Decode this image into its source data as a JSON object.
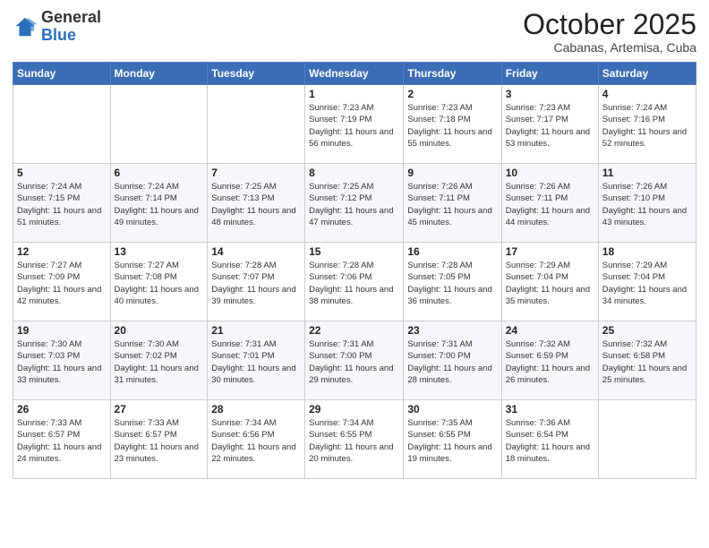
{
  "header": {
    "logo_general": "General",
    "logo_blue": "Blue",
    "month_title": "October 2025",
    "subtitle": "Cabanas, Artemisa, Cuba"
  },
  "weekdays": [
    "Sunday",
    "Monday",
    "Tuesday",
    "Wednesday",
    "Thursday",
    "Friday",
    "Saturday"
  ],
  "weeks": [
    [
      {
        "day": "",
        "info": ""
      },
      {
        "day": "",
        "info": ""
      },
      {
        "day": "",
        "info": ""
      },
      {
        "day": "1",
        "info": "Sunrise: 7:23 AM\nSunset: 7:19 PM\nDaylight: 11 hours and 56 minutes."
      },
      {
        "day": "2",
        "info": "Sunrise: 7:23 AM\nSunset: 7:18 PM\nDaylight: 11 hours and 55 minutes."
      },
      {
        "day": "3",
        "info": "Sunrise: 7:23 AM\nSunset: 7:17 PM\nDaylight: 11 hours and 53 minutes."
      },
      {
        "day": "4",
        "info": "Sunrise: 7:24 AM\nSunset: 7:16 PM\nDaylight: 11 hours and 52 minutes."
      }
    ],
    [
      {
        "day": "5",
        "info": "Sunrise: 7:24 AM\nSunset: 7:15 PM\nDaylight: 11 hours and 51 minutes."
      },
      {
        "day": "6",
        "info": "Sunrise: 7:24 AM\nSunset: 7:14 PM\nDaylight: 11 hours and 49 minutes."
      },
      {
        "day": "7",
        "info": "Sunrise: 7:25 AM\nSunset: 7:13 PM\nDaylight: 11 hours and 48 minutes."
      },
      {
        "day": "8",
        "info": "Sunrise: 7:25 AM\nSunset: 7:12 PM\nDaylight: 11 hours and 47 minutes."
      },
      {
        "day": "9",
        "info": "Sunrise: 7:26 AM\nSunset: 7:11 PM\nDaylight: 11 hours and 45 minutes."
      },
      {
        "day": "10",
        "info": "Sunrise: 7:26 AM\nSunset: 7:11 PM\nDaylight: 11 hours and 44 minutes."
      },
      {
        "day": "11",
        "info": "Sunrise: 7:26 AM\nSunset: 7:10 PM\nDaylight: 11 hours and 43 minutes."
      }
    ],
    [
      {
        "day": "12",
        "info": "Sunrise: 7:27 AM\nSunset: 7:09 PM\nDaylight: 11 hours and 42 minutes."
      },
      {
        "day": "13",
        "info": "Sunrise: 7:27 AM\nSunset: 7:08 PM\nDaylight: 11 hours and 40 minutes."
      },
      {
        "day": "14",
        "info": "Sunrise: 7:28 AM\nSunset: 7:07 PM\nDaylight: 11 hours and 39 minutes."
      },
      {
        "day": "15",
        "info": "Sunrise: 7:28 AM\nSunset: 7:06 PM\nDaylight: 11 hours and 38 minutes."
      },
      {
        "day": "16",
        "info": "Sunrise: 7:28 AM\nSunset: 7:05 PM\nDaylight: 11 hours and 36 minutes."
      },
      {
        "day": "17",
        "info": "Sunrise: 7:29 AM\nSunset: 7:04 PM\nDaylight: 11 hours and 35 minutes."
      },
      {
        "day": "18",
        "info": "Sunrise: 7:29 AM\nSunset: 7:04 PM\nDaylight: 11 hours and 34 minutes."
      }
    ],
    [
      {
        "day": "19",
        "info": "Sunrise: 7:30 AM\nSunset: 7:03 PM\nDaylight: 11 hours and 33 minutes."
      },
      {
        "day": "20",
        "info": "Sunrise: 7:30 AM\nSunset: 7:02 PM\nDaylight: 11 hours and 31 minutes."
      },
      {
        "day": "21",
        "info": "Sunrise: 7:31 AM\nSunset: 7:01 PM\nDaylight: 11 hours and 30 minutes."
      },
      {
        "day": "22",
        "info": "Sunrise: 7:31 AM\nSunset: 7:00 PM\nDaylight: 11 hours and 29 minutes."
      },
      {
        "day": "23",
        "info": "Sunrise: 7:31 AM\nSunset: 7:00 PM\nDaylight: 11 hours and 28 minutes."
      },
      {
        "day": "24",
        "info": "Sunrise: 7:32 AM\nSunset: 6:59 PM\nDaylight: 11 hours and 26 minutes."
      },
      {
        "day": "25",
        "info": "Sunrise: 7:32 AM\nSunset: 6:58 PM\nDaylight: 11 hours and 25 minutes."
      }
    ],
    [
      {
        "day": "26",
        "info": "Sunrise: 7:33 AM\nSunset: 6:57 PM\nDaylight: 11 hours and 24 minutes."
      },
      {
        "day": "27",
        "info": "Sunrise: 7:33 AM\nSunset: 6:57 PM\nDaylight: 11 hours and 23 minutes."
      },
      {
        "day": "28",
        "info": "Sunrise: 7:34 AM\nSunset: 6:56 PM\nDaylight: 11 hours and 22 minutes."
      },
      {
        "day": "29",
        "info": "Sunrise: 7:34 AM\nSunset: 6:55 PM\nDaylight: 11 hours and 20 minutes."
      },
      {
        "day": "30",
        "info": "Sunrise: 7:35 AM\nSunset: 6:55 PM\nDaylight: 11 hours and 19 minutes."
      },
      {
        "day": "31",
        "info": "Sunrise: 7:36 AM\nSunset: 6:54 PM\nDaylight: 11 hours and 18 minutes."
      },
      {
        "day": "",
        "info": ""
      }
    ]
  ]
}
